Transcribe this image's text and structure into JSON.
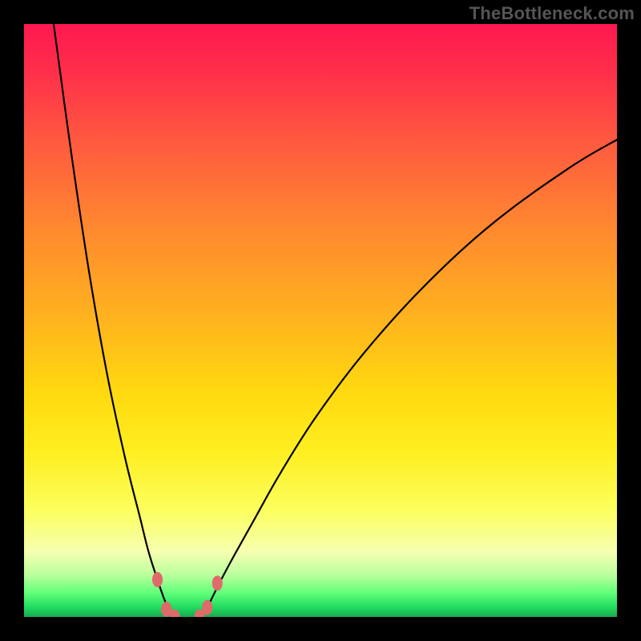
{
  "watermark": "TheBottleneck.com",
  "chart_data": {
    "type": "line",
    "title": "",
    "xlabel": "",
    "ylabel": "",
    "xlim": [
      0,
      100
    ],
    "ylim": [
      0,
      100
    ],
    "grid": false,
    "legend": false,
    "series": [
      {
        "name": "left-curve",
        "x": [
          5,
          8,
          11,
          14,
          17,
          19.5,
          21,
          22.5,
          23.5,
          24.2,
          24.8,
          25.4
        ],
        "values": [
          100,
          78,
          58,
          41,
          27,
          17,
          11,
          6.3,
          3.4,
          1.7,
          0.5,
          0
        ]
      },
      {
        "name": "right-curve",
        "x": [
          29.6,
          30.2,
          30.9,
          31.8,
          33.2,
          35.4,
          38.7,
          43.2,
          49.2,
          57.4,
          67.6,
          79.2,
          91.9,
          100
        ],
        "values": [
          0,
          0.5,
          1.6,
          3.4,
          6.2,
          10.3,
          16.2,
          24.2,
          33.7,
          44.6,
          55.9,
          66.5,
          75.7,
          80.5
        ]
      }
    ],
    "markers": {
      "x": [
        22.5,
        24.0,
        25.4,
        29.6,
        30.9,
        32.6
      ],
      "values": [
        6.3,
        1.3,
        0,
        0,
        1.6,
        5.7
      ],
      "color": "#e06a6a"
    },
    "gradient_stops": [
      {
        "pos": 0,
        "color": "#ff1850"
      },
      {
        "pos": 20,
        "color": "#ff5a3f"
      },
      {
        "pos": 50,
        "color": "#ffb41e"
      },
      {
        "pos": 82,
        "color": "#fcff5e"
      },
      {
        "pos": 96,
        "color": "#5fff78"
      },
      {
        "pos": 100,
        "color": "#1aa84f"
      }
    ]
  }
}
